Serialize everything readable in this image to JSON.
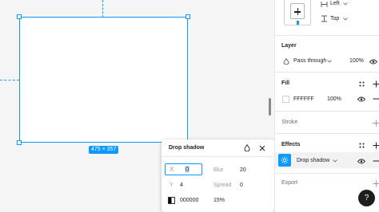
{
  "canvas": {
    "frame_size": "475 × 357"
  },
  "effect_popup": {
    "title": "Drop shadow",
    "x_label": "X",
    "x_value": "0",
    "y_label": "Y",
    "y_value": "4",
    "blur_label": "Blur",
    "blur_value": "20",
    "spread_label": "Spread",
    "spread_value": "0",
    "color_hex": "000000",
    "opacity": "15%",
    "icons": [
      "water-drop-icon",
      "close-icon"
    ]
  },
  "panel": {
    "constraints": {
      "horizontal": "Left",
      "vertical": "Top"
    },
    "layer": {
      "title": "Layer",
      "blend_mode": "Pass through",
      "opacity": "100%"
    },
    "fill": {
      "title": "Fill",
      "hex": "FFFFFF",
      "opacity": "100%",
      "swatch_color": "#FFFFFF"
    },
    "stroke": {
      "title": "Stroke"
    },
    "effects": {
      "title": "Effects",
      "item_label": "Drop shadow"
    },
    "export": {
      "title": "Export"
    },
    "help_label": "?"
  },
  "colors": {
    "accent": "#0d99ff",
    "effect_row_bg": "#f2f2f2",
    "canvas_bg": "#f5f5f5"
  }
}
